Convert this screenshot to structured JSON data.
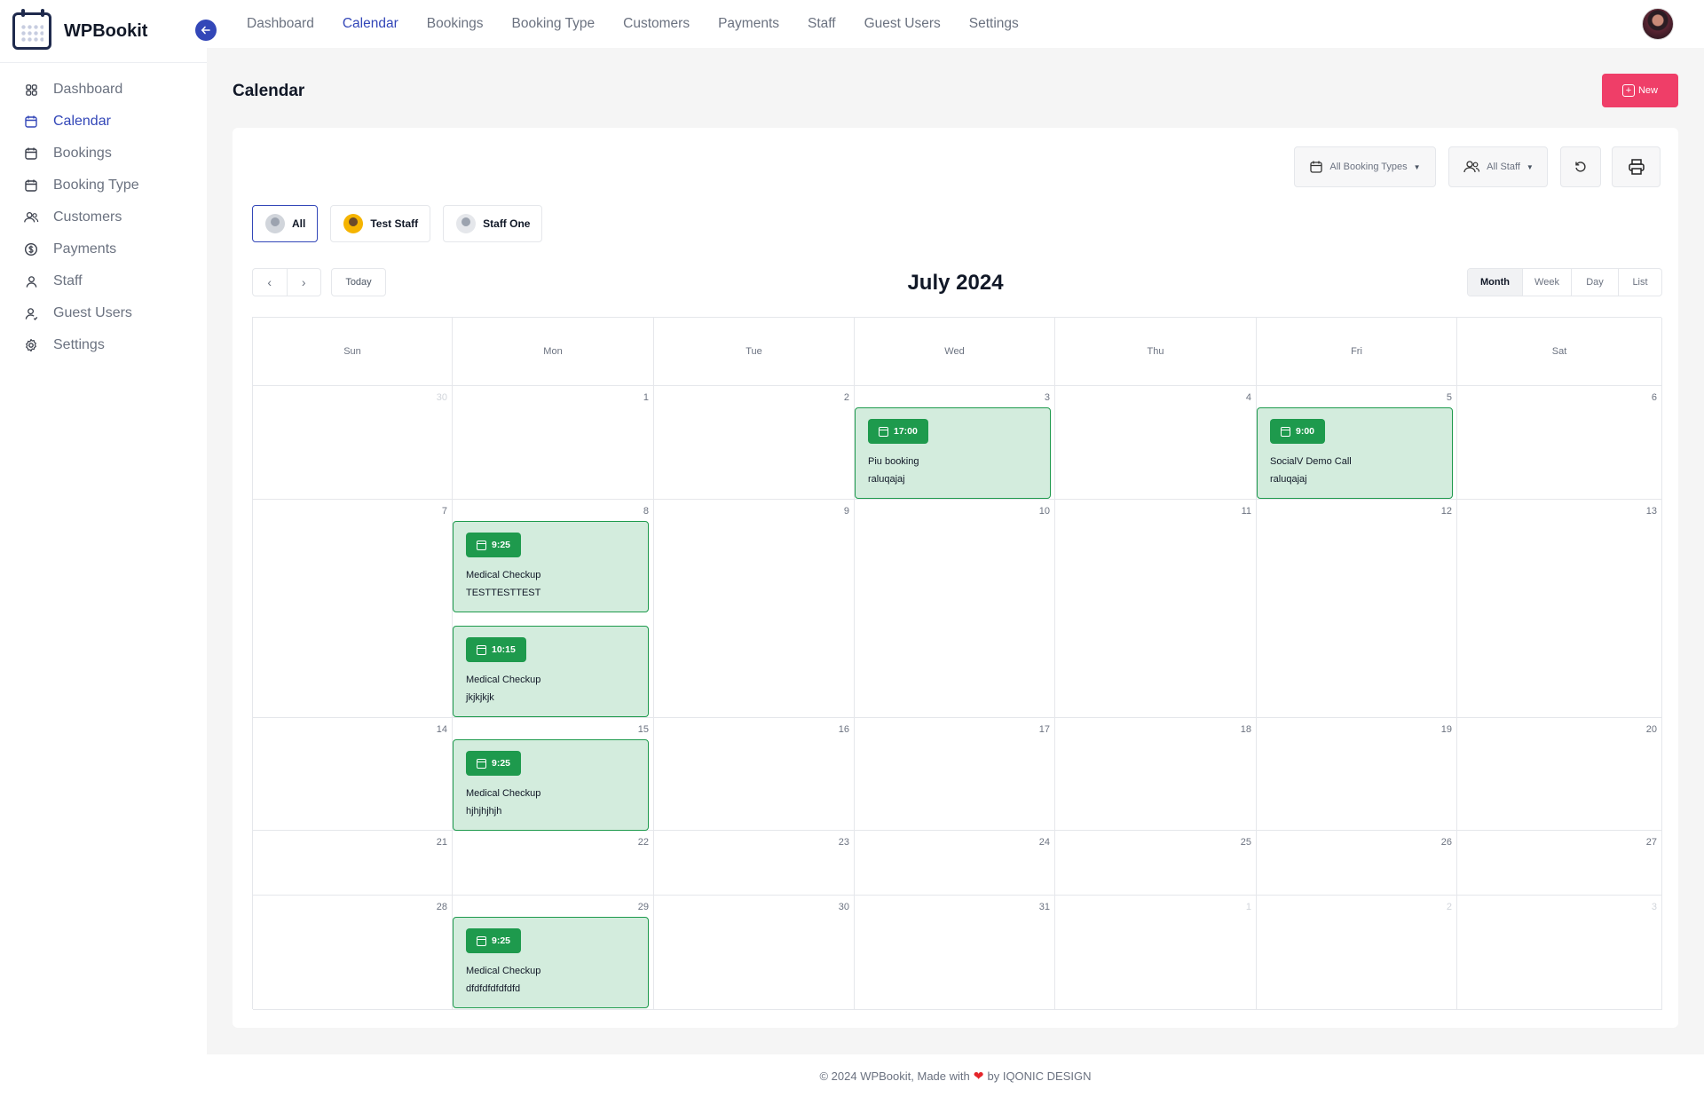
{
  "app": {
    "name": "WPBookit"
  },
  "sidebar": {
    "items": [
      {
        "label": "Dashboard",
        "icon": "grid-icon",
        "active": false
      },
      {
        "label": "Calendar",
        "icon": "calendar-icon",
        "active": true
      },
      {
        "label": "Bookings",
        "icon": "calendar-icon",
        "active": false
      },
      {
        "label": "Booking Type",
        "icon": "calendar-icon",
        "active": false
      },
      {
        "label": "Customers",
        "icon": "users-icon",
        "active": false
      },
      {
        "label": "Payments",
        "icon": "dollar-icon",
        "active": false
      },
      {
        "label": "Staff",
        "icon": "user-icon",
        "active": false
      },
      {
        "label": "Guest Users",
        "icon": "guest-icon",
        "active": false
      },
      {
        "label": "Settings",
        "icon": "gear-icon",
        "active": false
      }
    ]
  },
  "topnav": {
    "items": [
      "Dashboard",
      "Calendar",
      "Bookings",
      "Booking Type",
      "Customers",
      "Payments",
      "Staff",
      "Guest Users",
      "Settings"
    ],
    "active": "Calendar"
  },
  "page": {
    "title": "Calendar",
    "new_button": "New"
  },
  "filters": {
    "booking_types": "All Booking Types",
    "staff": "All Staff"
  },
  "staff_chips": [
    {
      "label": "All",
      "active": true
    },
    {
      "label": "Test Staff",
      "active": false
    },
    {
      "label": "Staff One",
      "active": false
    }
  ],
  "calendar": {
    "title": "July 2024",
    "today_label": "Today",
    "prev_label": "‹",
    "next_label": "›",
    "views": [
      "Month",
      "Week",
      "Day",
      "List"
    ],
    "active_view": "Month",
    "weekdays": [
      "Sun",
      "Mon",
      "Tue",
      "Wed",
      "Thu",
      "Fri",
      "Sat"
    ],
    "weeks": [
      [
        30,
        1,
        2,
        3,
        4,
        5,
        6
      ],
      [
        7,
        8,
        9,
        10,
        11,
        12,
        13
      ],
      [
        14,
        15,
        16,
        17,
        18,
        19,
        20
      ],
      [
        21,
        22,
        23,
        24,
        25,
        26,
        27
      ],
      [
        28,
        29,
        30,
        31,
        1,
        2,
        3
      ]
    ],
    "events": [
      {
        "week": 0,
        "day": 3,
        "slot": 0,
        "time": "17:00",
        "title": "Piu booking",
        "customer": "raluqajaj"
      },
      {
        "week": 0,
        "day": 5,
        "slot": 0,
        "time": "9:00",
        "title": "SocialV Demo Call",
        "customer": "raluqajaj"
      },
      {
        "week": 1,
        "day": 1,
        "slot": 0,
        "time": "9:25",
        "title": "Medical Checkup",
        "customer": "TESTTESTTEST"
      },
      {
        "week": 1,
        "day": 1,
        "slot": 1,
        "time": "10:15",
        "title": "Medical Checkup",
        "customer": "jkjkjkjk"
      },
      {
        "week": 2,
        "day": 1,
        "slot": 0,
        "time": "9:25",
        "title": "Medical Checkup",
        "customer": "hjhjhjhjh"
      },
      {
        "week": 4,
        "day": 1,
        "slot": 0,
        "time": "9:25",
        "title": "Medical Checkup",
        "customer": "dfdfdfdfdfdfd"
      }
    ],
    "event_color": "#1e9a4d"
  },
  "footer": {
    "prefix": "© 2024 WPBookit, Made with",
    "heart": "❤",
    "suffix": "by IQONIC DESIGN"
  },
  "colors": {
    "accent": "#3347b8",
    "primary_button": "#ef3e68",
    "event_bg": "#d3ecdd"
  }
}
